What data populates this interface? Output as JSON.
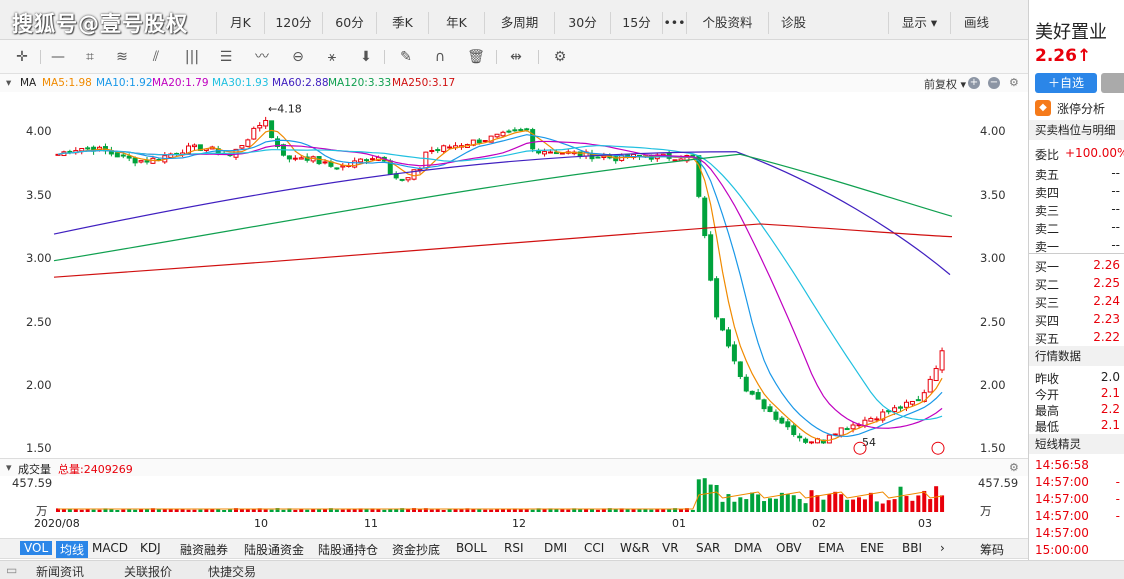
{
  "watermark": "搜狐号@壹号股权",
  "period_tabs": [
    "月K",
    "120分",
    "60分",
    "季K",
    "年K",
    "多周期",
    "30分",
    "15分",
    "•••",
    "个股资料",
    "诊股",
    "显示 ▾",
    "画线"
  ],
  "ma_header": {
    "label": "MA",
    "items": [
      {
        "text": "MA5:1.98",
        "color": "#f08a00"
      },
      {
        "text": "MA10:1.92",
        "color": "#1a98e8"
      },
      {
        "text": "MA20:1.79",
        "color": "#c000c0"
      },
      {
        "text": "MA30:1.93",
        "color": "#20c0e0"
      },
      {
        "text": "MA60:2.88",
        "color": "#4020c0"
      },
      {
        "text": "MA120:3.33",
        "color": "#10a050"
      },
      {
        "text": "MA250:3.17",
        "color": "#d01010"
      }
    ],
    "adjust": "前复权 ▾"
  },
  "chart_data": {
    "type": "candlestick",
    "y_ticks": [
      "4.00",
      "3.50",
      "3.00",
      "2.50",
      "2.00",
      "1.50"
    ],
    "ylim": [
      1.47,
      4.28
    ],
    "x_ticks": [
      "2020/08",
      "10",
      "11",
      "12",
      "01",
      "02",
      "03"
    ],
    "annotations": {
      "high": "←4.18",
      "low": "54"
    },
    "series_colors": {
      "up": "#e8000b",
      "down": "#00a23c"
    }
  },
  "volume": {
    "label": "成交量",
    "total": "总量:2409269",
    "top": "457.59",
    "unit": "万"
  },
  "indicators": [
    "VOL",
    "均线",
    "MACD",
    "KDJ",
    "融资融券",
    "陆股通资金",
    "陆股通持仓",
    "资金抄底",
    "BOLL",
    "RSI",
    "DMI",
    "CCI",
    "W&R",
    "VR",
    "SAR",
    "DMA",
    "OBV",
    "EMA",
    "ENE",
    "BBI",
    "›",
    "筹码"
  ],
  "bottom_tabs": [
    "新闻资讯",
    "关联报价",
    "快捷交易"
  ],
  "panel": {
    "name": "美好置业",
    "price": "2.26",
    "arrow": "↑",
    "add_btn": "＋自选",
    "limit_analysis": "涨停分析",
    "order_title": "买卖档位与明细",
    "wei_bi": "委比",
    "wei_bi_val": "+100.00%",
    "sells": [
      {
        "l": "卖五",
        "v": "--"
      },
      {
        "l": "卖四",
        "v": "--"
      },
      {
        "l": "卖三",
        "v": "--"
      },
      {
        "l": "卖二",
        "v": "--"
      },
      {
        "l": "卖一",
        "v": "--"
      }
    ],
    "buys": [
      {
        "l": "买一",
        "v": "2.26"
      },
      {
        "l": "买二",
        "v": "2.25"
      },
      {
        "l": "买三",
        "v": "2.24"
      },
      {
        "l": "买四",
        "v": "2.23"
      },
      {
        "l": "买五",
        "v": "2.22"
      }
    ],
    "market_title": "行情数据",
    "market": [
      {
        "l": "昨收",
        "v": "2.0"
      },
      {
        "l": "今开",
        "v": "2.1"
      },
      {
        "l": "最高",
        "v": "2.2"
      },
      {
        "l": "最低",
        "v": "2.1"
      }
    ],
    "sprite_title": "短线精灵",
    "times": [
      {
        "t": "14:56:58",
        "v": ""
      },
      {
        "t": "14:57:00",
        "v": "-"
      },
      {
        "t": "14:57:00",
        "v": "-"
      },
      {
        "t": "14:57:00",
        "v": "-"
      },
      {
        "t": "14:57:00",
        "v": ""
      },
      {
        "t": "15:00:00",
        "v": ""
      },
      {
        "t": "15:00:00",
        "v": ""
      }
    ]
  }
}
